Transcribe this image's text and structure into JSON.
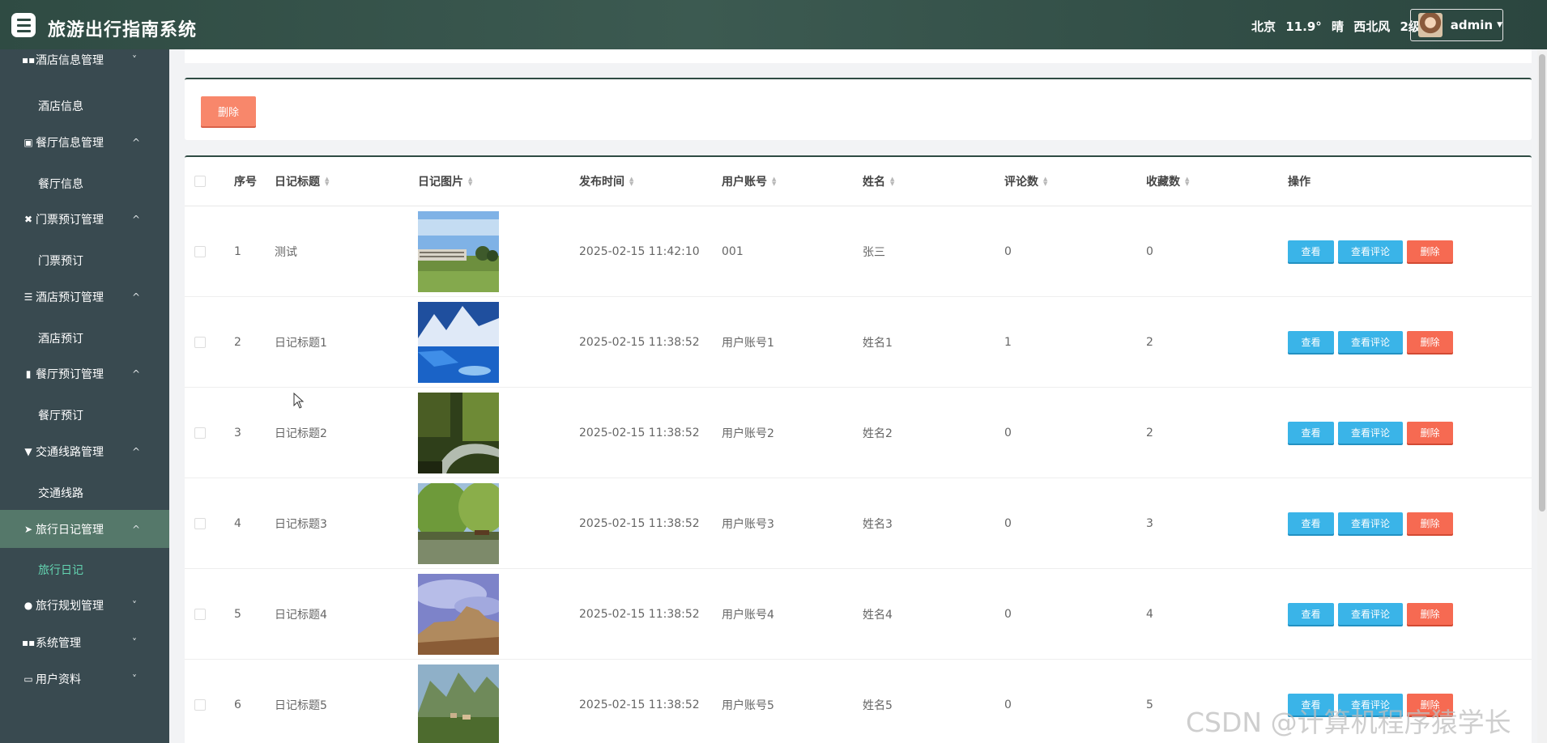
{
  "header": {
    "app_title": "旅游出行指南系统",
    "weather": {
      "city": "北京",
      "temperature": "11.9°",
      "condition": "晴",
      "wind": "西北风",
      "level": "2级"
    },
    "user": {
      "name": "admin"
    }
  },
  "sidebar": {
    "items": [
      {
        "label": "酒店信息管理",
        "kind": "group",
        "icon": "grid-icon",
        "arrow": "˅"
      },
      {
        "label": "酒店信息",
        "kind": "sub"
      },
      {
        "label": "餐厅信息管理",
        "kind": "group",
        "icon": "clipboard-icon",
        "arrow": "^"
      },
      {
        "label": "餐厅信息",
        "kind": "sub"
      },
      {
        "label": "门票预订管理",
        "kind": "group",
        "icon": "ticket-icon",
        "arrow": "^"
      },
      {
        "label": "门票预订",
        "kind": "sub"
      },
      {
        "label": "酒店预订管理",
        "kind": "group",
        "icon": "list-icon",
        "arrow": "^"
      },
      {
        "label": "酒店预订",
        "kind": "sub"
      },
      {
        "label": "餐厅预订管理",
        "kind": "group",
        "icon": "bar-chart-icon",
        "arrow": "^"
      },
      {
        "label": "餐厅预订",
        "kind": "sub"
      },
      {
        "label": "交通线路管理",
        "kind": "group",
        "icon": "trophy-icon",
        "arrow": "^"
      },
      {
        "label": "交通线路",
        "kind": "sub"
      },
      {
        "label": "旅行日记管理",
        "kind": "group",
        "icon": "send-icon",
        "arrow": "^",
        "active": true
      },
      {
        "label": "旅行日记",
        "kind": "sub",
        "current": true
      },
      {
        "label": "旅行规划管理",
        "kind": "group",
        "icon": "map-pin-icon",
        "arrow": "˅"
      },
      {
        "label": "系统管理",
        "kind": "group",
        "icon": "grid-icon",
        "arrow": "˅"
      },
      {
        "label": "用户资料",
        "kind": "group",
        "icon": "id-card-icon",
        "arrow": "˅"
      }
    ]
  },
  "toolbar": {
    "delete_label": "删除"
  },
  "table": {
    "columns": [
      "序号",
      "日记标题",
      "日记图片",
      "发布时间",
      "用户账号",
      "姓名",
      "评论数",
      "收藏数",
      "操作"
    ],
    "rows": [
      {
        "index": "1",
        "title": "测试",
        "image": "building-photo",
        "time": "2025-02-15 11:42:10",
        "account": "001",
        "name": "张三",
        "comments": "0",
        "favorites": "0"
      },
      {
        "index": "2",
        "title": "日记标题1",
        "image": "glacier-lake-photo",
        "time": "2025-02-15 11:38:52",
        "account": "用户账号1",
        "name": "姓名1",
        "comments": "1",
        "favorites": "2"
      },
      {
        "index": "3",
        "title": "日记标题2",
        "image": "forest-river-photo",
        "time": "2025-02-15 11:38:52",
        "account": "用户账号2",
        "name": "姓名2",
        "comments": "0",
        "favorites": "2"
      },
      {
        "index": "4",
        "title": "日记标题3",
        "image": "willow-lake-photo",
        "time": "2025-02-15 11:38:52",
        "account": "用户账号3",
        "name": "姓名3",
        "comments": "0",
        "favorites": "3"
      },
      {
        "index": "5",
        "title": "日记标题4",
        "image": "mesa-photo",
        "time": "2025-02-15 11:38:52",
        "account": "用户账号4",
        "name": "姓名4",
        "comments": "0",
        "favorites": "4"
      },
      {
        "index": "6",
        "title": "日记标题5",
        "image": "mountain-village-photo",
        "time": "2025-02-15 11:38:52",
        "account": "用户账号5",
        "name": "姓名5",
        "comments": "0",
        "favorites": "5"
      }
    ],
    "actions": {
      "view": "查看",
      "view_comments": "查看评论",
      "delete": "删除"
    }
  },
  "watermark": "CSDN @计算机程序猿学长",
  "colors": {
    "header": "#2f4b43",
    "sidebar": "#394a50",
    "active_menu": "#55786a",
    "current_sub": "#63d3b0",
    "primary_btn": "#3ab4e8",
    "danger_btn": "#f66a52",
    "batch_delete": "#f8876b"
  }
}
